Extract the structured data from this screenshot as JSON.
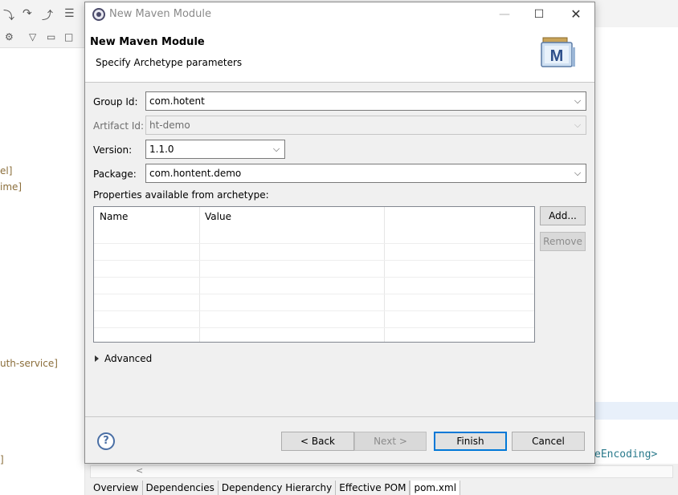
{
  "background": {
    "tree_fragments": [
      "el]",
      "ime]",
      "uth-service]",
      "]"
    ],
    "code_fragment": "eEncoding>",
    "editor_tabs": [
      "Overview",
      "Dependencies",
      "Dependency Hierarchy",
      "Effective POM",
      "pom.xml"
    ],
    "scroll_left_glyph": "<"
  },
  "dialog": {
    "window_title": "New Maven Module",
    "header_title": "New Maven Module",
    "header_subtitle": "Specify Archetype parameters",
    "logo_letter": "M",
    "form": {
      "group_id_label": "Group Id:",
      "group_id_value": "com.hotent",
      "artifact_id_label": "Artifact Id:",
      "artifact_id_value": "ht-demo",
      "version_label": "Version:",
      "version_value": "1.1.0",
      "package_label": "Package:",
      "package_value": "com.hontent.demo"
    },
    "properties": {
      "label": "Properties available from archetype:",
      "columns": [
        "Name",
        "Value"
      ],
      "rows": [],
      "add_button": "Add...",
      "remove_button": "Remove"
    },
    "advanced_label": "Advanced",
    "buttons": {
      "back": "< Back",
      "next": "Next >",
      "finish": "Finish",
      "cancel": "Cancel"
    },
    "help_glyph": "?"
  },
  "colors": {
    "accent": "#0078d7",
    "tree_text": "#8b6e3b",
    "code_text": "#2a7a8c"
  }
}
